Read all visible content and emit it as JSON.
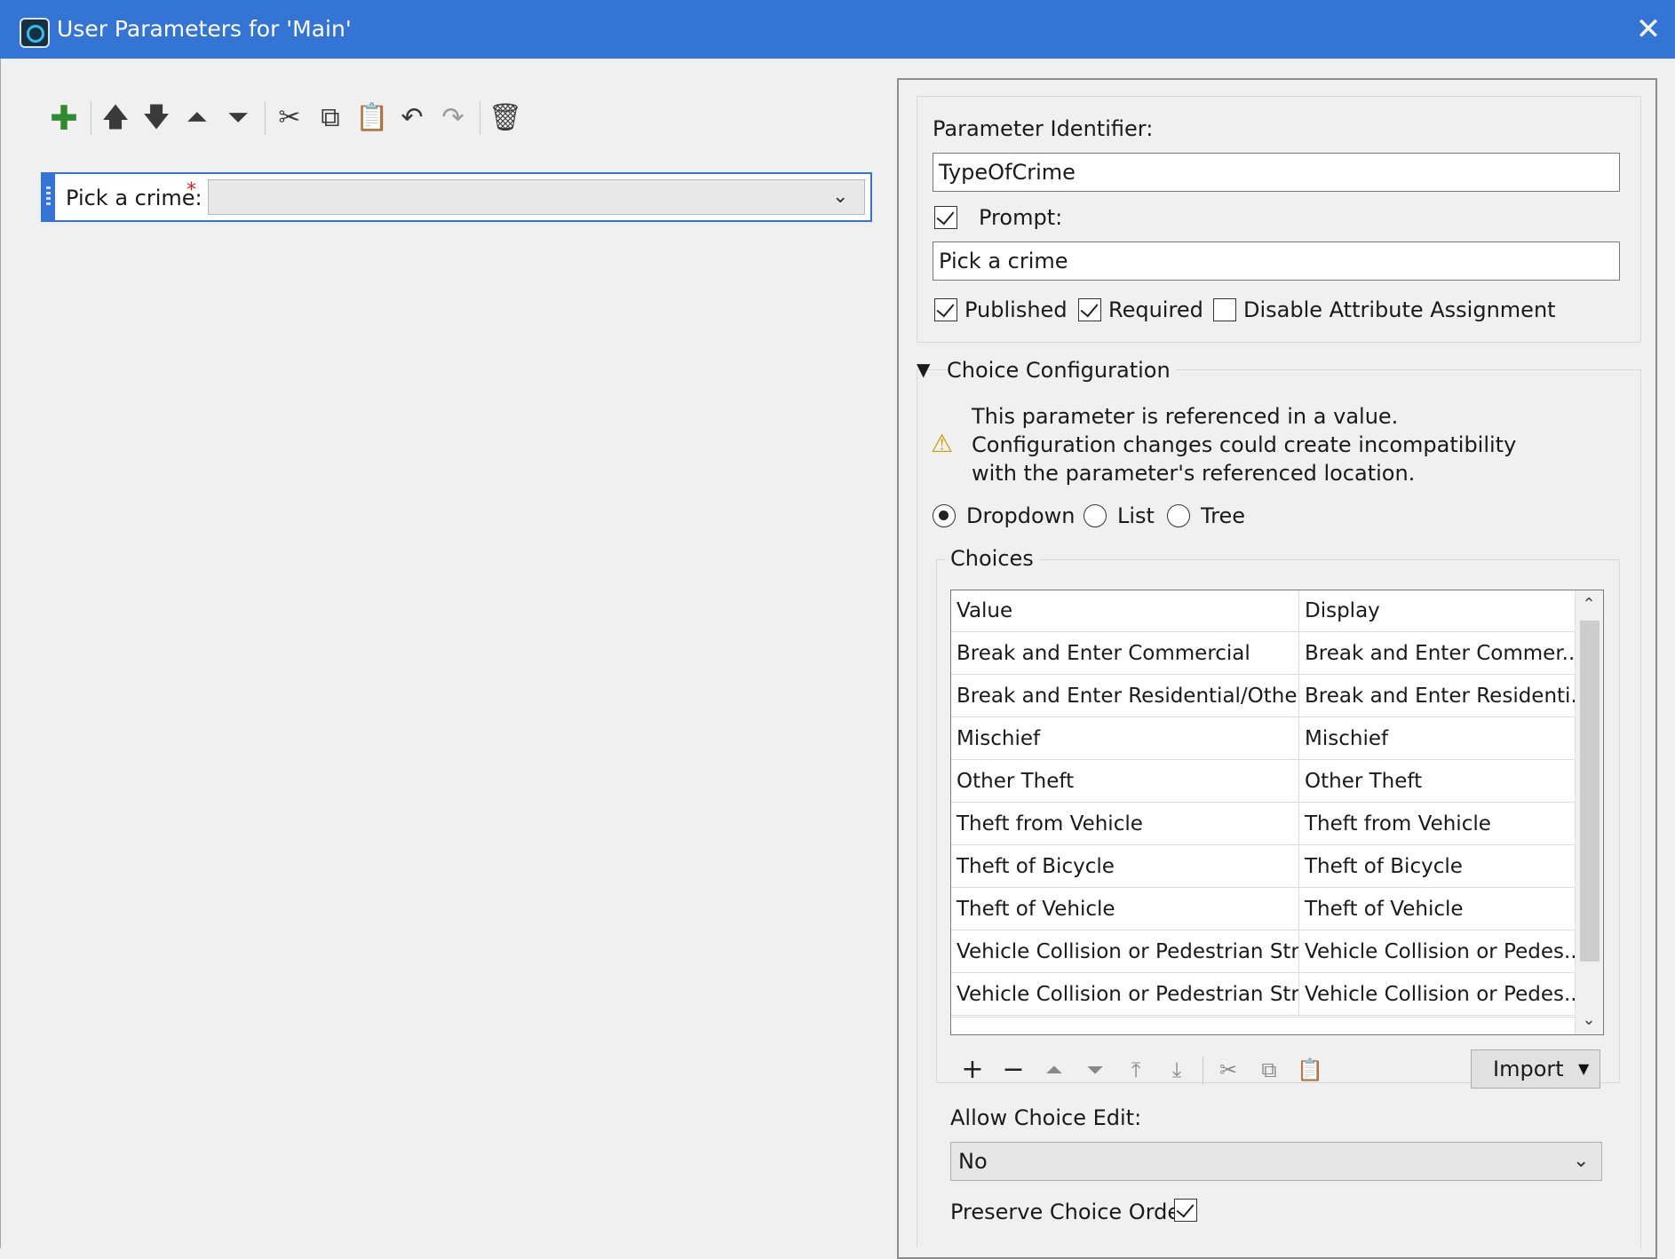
{
  "window": {
    "title": "User Parameters for 'Main'",
    "close_glyph": "✕",
    "colors": {
      "titlebar": "#3474d4",
      "accent": "#3474d4",
      "required": "#e02020"
    }
  },
  "toolbar": {
    "icons": [
      "add-parameter-icon",
      "move-up-icon",
      "move-down-icon",
      "move-to-top-icon",
      "move-to-bottom-icon",
      "cut-icon",
      "copy-icon",
      "paste-icon",
      "undo-icon",
      "redo-icon",
      "delete-icon"
    ]
  },
  "parameter_row": {
    "label": "Pick a crime:",
    "required_marker": "*",
    "value": ""
  },
  "details": {
    "identifier_label": "Parameter Identifier:",
    "identifier_value": "TypeOfCrime",
    "prompt_label": "Prompt:",
    "prompt_checked": true,
    "prompt_value": "Pick a crime",
    "published_label": "Published",
    "published_checked": true,
    "required_label": "Required",
    "required_checked": true,
    "disable_assign_label": "Disable Attribute Assignment",
    "disable_assign_checked": false
  },
  "choice_config": {
    "section_title": "Choice Configuration",
    "warning_lines": [
      "This parameter is referenced in a value.",
      "Configuration changes could create incompatibility",
      "with the parameter's referenced location."
    ],
    "modes": [
      {
        "label": "Dropdown",
        "selected": true
      },
      {
        "label": "List",
        "selected": false
      },
      {
        "label": "Tree",
        "selected": false
      }
    ],
    "choices_label": "Choices",
    "table": {
      "headers": [
        "Value",
        "Display"
      ],
      "rows": [
        [
          "Break and Enter Commercial",
          "Break and Enter Commer..."
        ],
        [
          "Break and Enter Residential/Other",
          "Break and Enter Residenti..."
        ],
        [
          "Mischief",
          "Mischief"
        ],
        [
          "Other Theft",
          "Other Theft"
        ],
        [
          "Theft from Vehicle",
          "Theft from Vehicle"
        ],
        [
          "Theft of Bicycle",
          "Theft of Bicycle"
        ],
        [
          "Theft of Vehicle",
          "Theft of Vehicle"
        ],
        [
          "Vehicle Collision or Pedestrian Str...",
          "Vehicle Collision or Pedes..."
        ],
        [
          "Vehicle Collision or Pedestrian Str...",
          "Vehicle Collision or Pedes..."
        ],
        [
          "",
          ""
        ]
      ]
    },
    "import_label": "Import",
    "allow_edit_label": "Allow Choice Edit:",
    "allow_edit_value": "No",
    "preserve_order_label": "Preserve Choice Order:",
    "preserve_order_checked": true
  }
}
